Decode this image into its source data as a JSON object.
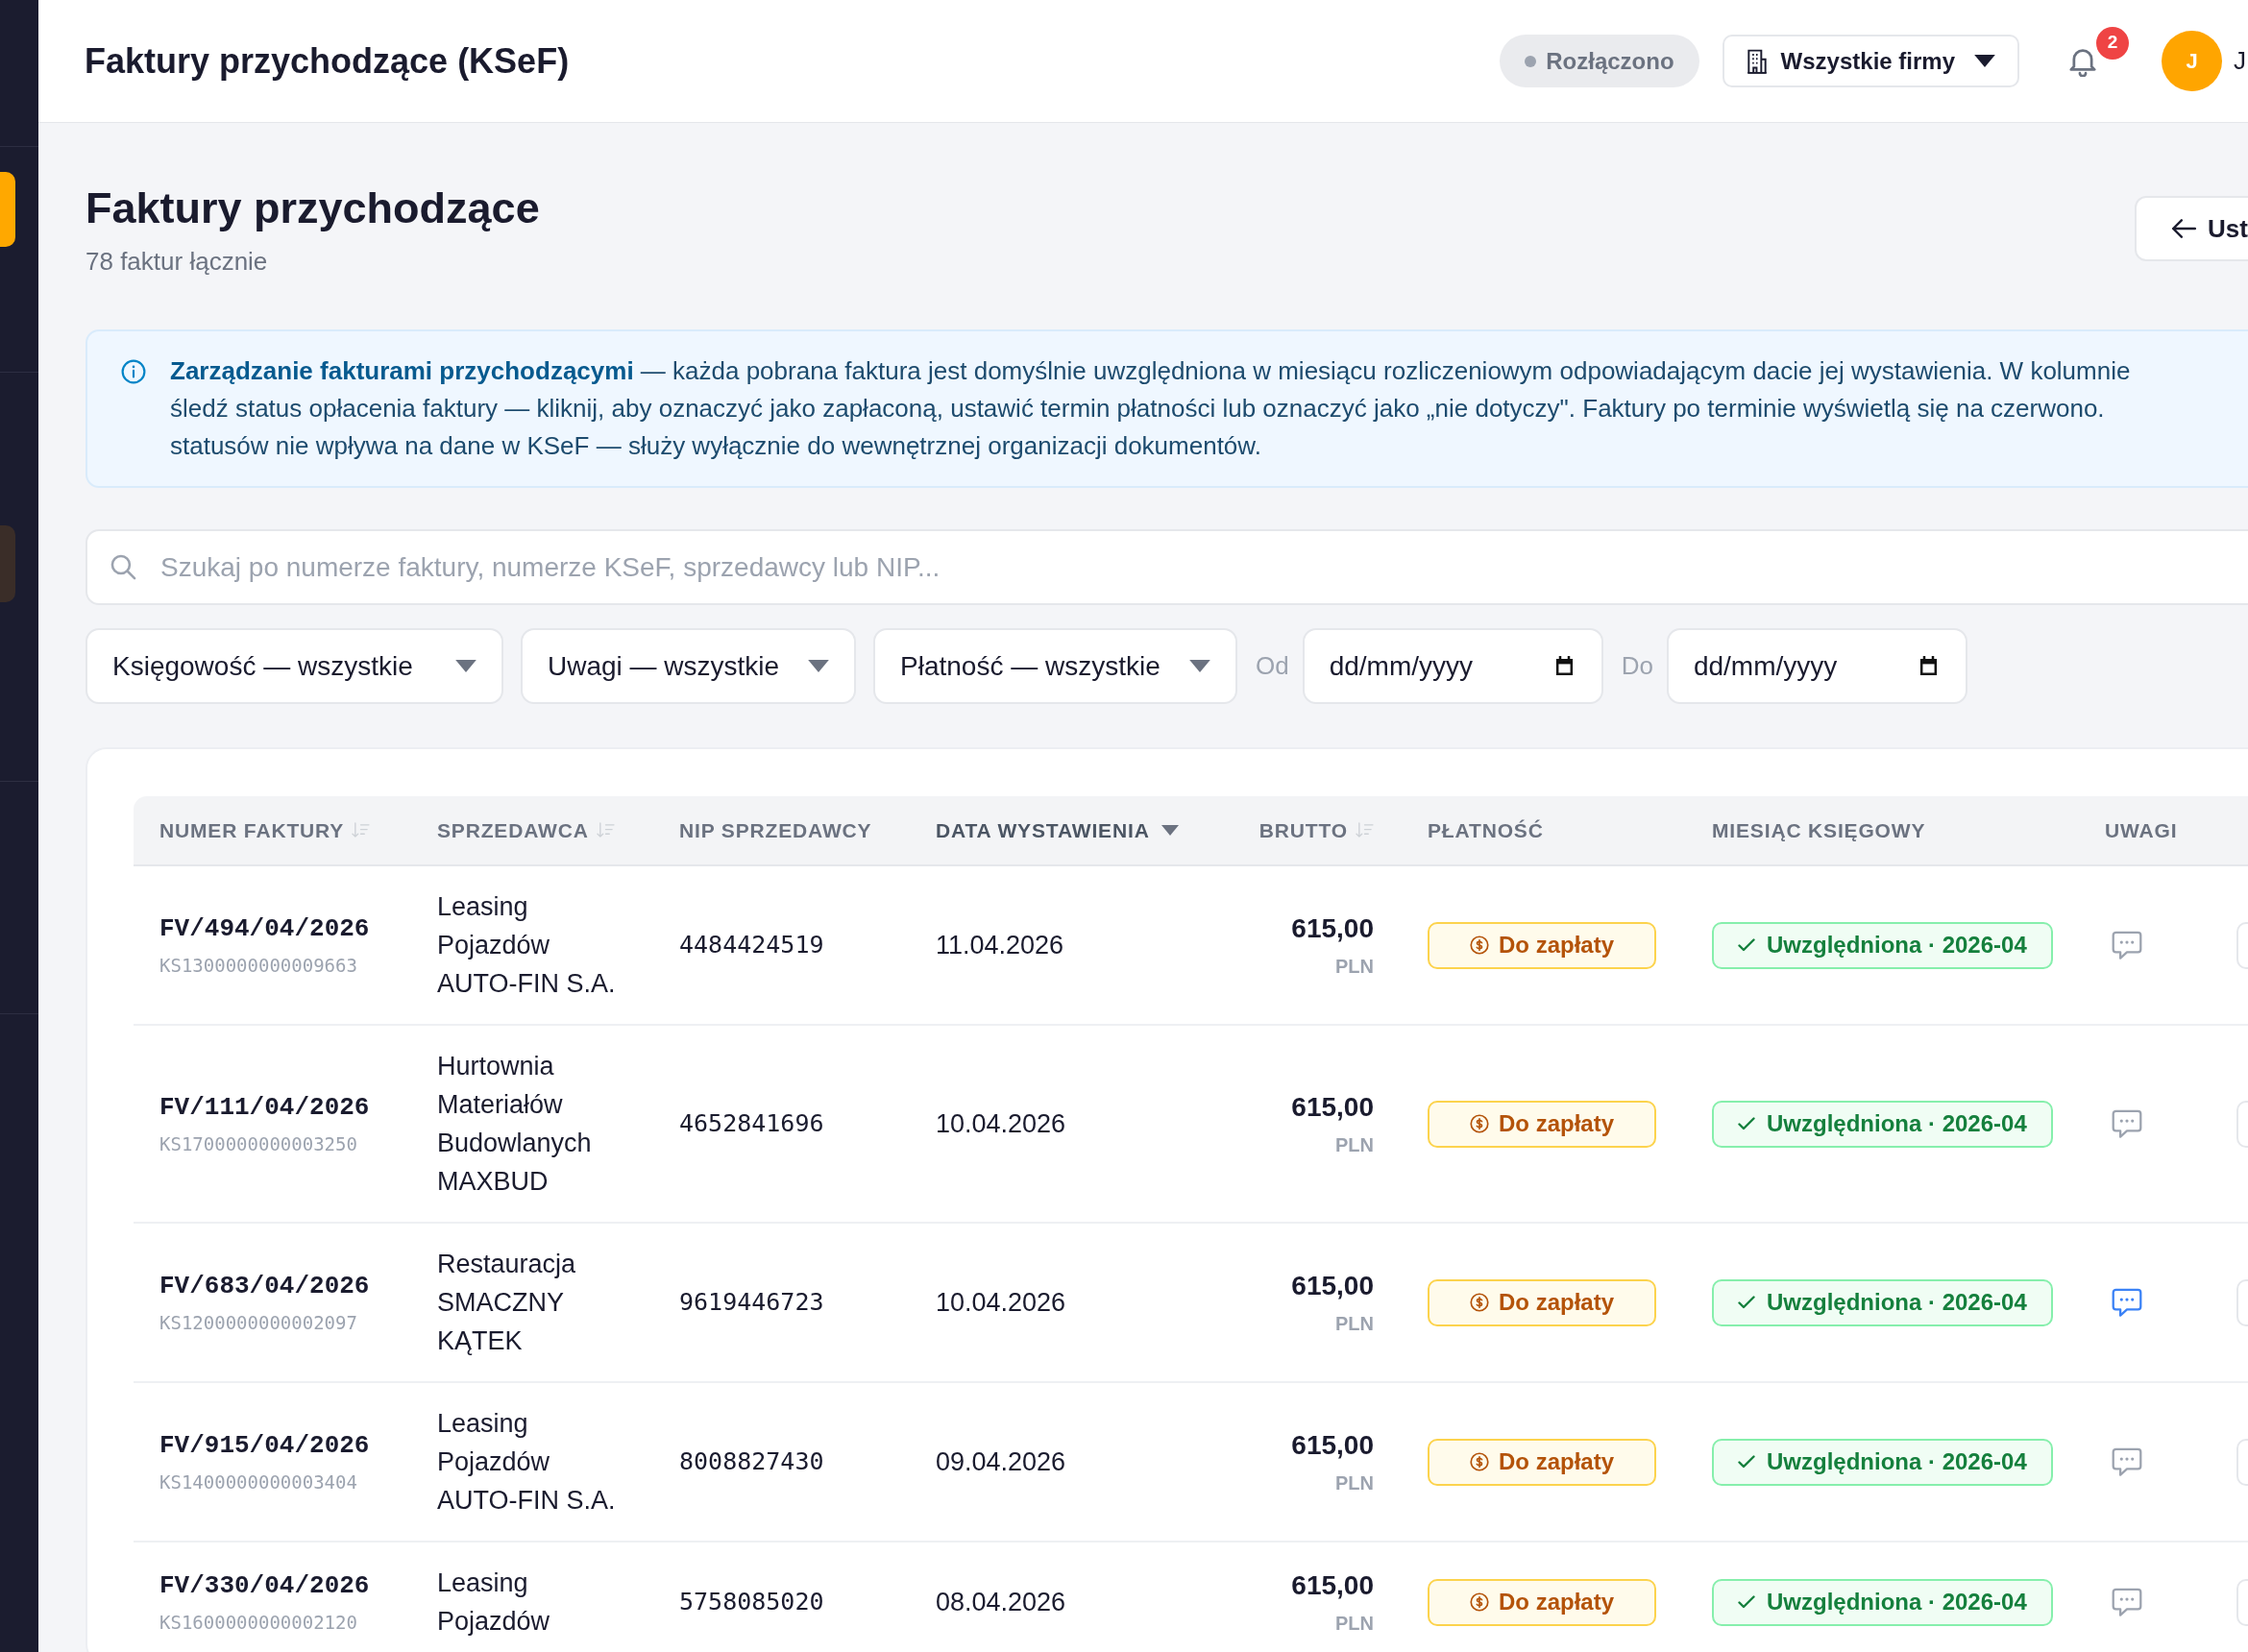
{
  "sidebar": {
    "items": [
      {
        "selected": true
      },
      {
        "selected": false
      }
    ]
  },
  "header": {
    "title": "Faktury przychodzące (KSeF)",
    "connection": {
      "label": "Rozłączono",
      "connected": false
    },
    "company_selector": {
      "label": "Wszystkie firmy"
    },
    "notifications": {
      "count": "2"
    },
    "user": {
      "initial": "J",
      "name": "J"
    }
  },
  "page": {
    "title": "Faktury przychodzące",
    "subtitle": "78 faktur łącznie",
    "back_button": {
      "label": "Ust"
    }
  },
  "info": {
    "lines": [
      "**Zarządzanie fakturami przychodzącymi** — każda pobrana faktura jest domyślnie uwzględniona w miesiącu rozliczeniowym odpowiadającym dacie jej wystawienia. W kolumnie",
      "śledź status opłacenia faktury — kliknij, aby oznaczyć jako zapłaconą, ustawić termin płatności lub oznaczyć jako „nie dotyczy\". Faktury po terminie wyświetlą się na czerwono.",
      "statusów nie wpływa na dane w KSeF — służy wyłącznie do wewnętrznej organizacji dokumentów."
    ]
  },
  "search": {
    "placeholder": "Szukaj po numerze faktury, numerze KSeF, sprzedawcy lub NIP..."
  },
  "filters": [
    {
      "kind": "select",
      "label": "Księgowość — wszystkie"
    },
    {
      "kind": "select",
      "label": "Uwagi — wszystkie"
    },
    {
      "kind": "select",
      "label": "Płatność — wszystkie"
    },
    {
      "kind": "date",
      "label": "Od",
      "placeholder": "dd/mm/yyyy"
    },
    {
      "kind": "date",
      "label": "Do",
      "placeholder": "dd/mm/yyyy"
    }
  ],
  "table": {
    "columns": [
      {
        "label": "NUMER FAKTURY",
        "sortable": true,
        "sorted": false
      },
      {
        "label": "SPRZEDAWCA",
        "sortable": true,
        "sorted": false
      },
      {
        "label": "NIP SPRZEDAWCY",
        "sortable": false,
        "sorted": false
      },
      {
        "label": "DATA WYSTAWIENIA",
        "sortable": true,
        "sorted": true
      },
      {
        "label": "BRUTTO",
        "sortable": true,
        "sorted": false
      },
      {
        "label": "PŁATNOŚĆ",
        "sortable": false,
        "sorted": false
      },
      {
        "label": "MIESIĄC KSIĘGOWY",
        "sortable": false,
        "sorted": false
      },
      {
        "label": "UWAGI",
        "sortable": false,
        "sorted": false
      }
    ],
    "rows": [
      {
        "number": "FV/494/04/2026",
        "ksef_id": "KS1300000000009663",
        "seller": "Leasing Pojazdów AUTO-FIN S.A.",
        "nip": "4484424519",
        "date": "11.04.2026",
        "gross": "615,00",
        "currency": "PLN",
        "payment": {
          "label": "Do zapłaty",
          "paid": false
        },
        "accounting": {
          "label": "Uwzględniona · 2026-04",
          "included": true
        },
        "has_note": false
      },
      {
        "number": "FV/111/04/2026",
        "ksef_id": "KS1700000000003250",
        "seller": "Hurtownia Materiałów Budowlanych MAXBUD",
        "nip": "4652841696",
        "date": "10.04.2026",
        "gross": "615,00",
        "currency": "PLN",
        "payment": {
          "label": "Do zapłaty",
          "paid": false
        },
        "accounting": {
          "label": "Uwzględniona · 2026-04",
          "included": true
        },
        "has_note": false
      },
      {
        "number": "FV/683/04/2026",
        "ksef_id": "KS1200000000002097",
        "seller": "Restauracja SMACZNY KĄTEK",
        "nip": "9619446723",
        "date": "10.04.2026",
        "gross": "615,00",
        "currency": "PLN",
        "payment": {
          "label": "Do zapłaty",
          "paid": false
        },
        "accounting": {
          "label": "Uwzględniona · 2026-04",
          "included": true
        },
        "has_note": true
      },
      {
        "number": "FV/915/04/2026",
        "ksef_id": "KS1400000000003404",
        "seller": "Leasing Pojazdów AUTO-FIN S.A.",
        "nip": "8008827430",
        "date": "09.04.2026",
        "gross": "615,00",
        "currency": "PLN",
        "payment": {
          "label": "Do zapłaty",
          "paid": false
        },
        "accounting": {
          "label": "Uwzględniona · 2026-04",
          "included": true
        },
        "has_note": false
      },
      {
        "number": "FV/330/04/2026",
        "ksef_id": "KS1600000000002120",
        "seller": "Leasing Pojazdów",
        "nip": "5758085020",
        "date": "08.04.2026",
        "gross": "615,00",
        "currency": "PLN",
        "payment": {
          "label": "Do zapłaty",
          "paid": false
        },
        "accounting": {
          "label": "Uwzględniona · 2026-04",
          "included": true
        },
        "has_note": false
      }
    ]
  }
}
